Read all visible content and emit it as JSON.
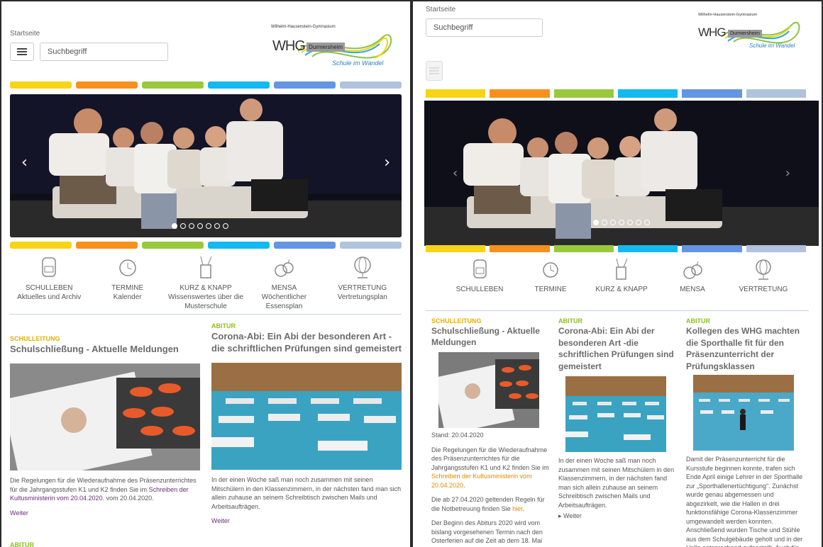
{
  "left": {
    "breadcrumb": "Startseite",
    "search_placeholder": "Suchbegriff",
    "logo": {
      "school": "Wilhelm-Hausenstein-Gymnasium",
      "short": "WHG",
      "town": "Durmersheim",
      "slogan": "Schule im Wandel"
    },
    "tiles": [
      {
        "title": "SCHULLEBEN",
        "sub": "Aktuelles und Archiv"
      },
      {
        "title": "TERMINE",
        "sub": "Kalender"
      },
      {
        "title": "KURZ & KNAPP",
        "sub": "Wissenswertes über die Musterschule"
      },
      {
        "title": "MENSA",
        "sub": "Wöchentlicher Essensplan"
      },
      {
        "title": "VERTRETUNG",
        "sub": "Vertretungsplan"
      }
    ],
    "articles": [
      {
        "category": "SCHULLEITUNG",
        "title": "Schulschließung - Aktuelle Meldungen",
        "text_before": "Die Regelungen für die Wiederaufnahme des Präsenzunterrichtes für die Jahrgangsstufen K1 und K2 finden Sie im ",
        "link": "Schreiben der Kultusministerin vom 20.04.2020",
        "text_after": ". vom 20.04.2020.",
        "more": "Weiter"
      },
      {
        "category": "ABITUR",
        "title": "Corona-Abi: Ein Abi der besonderen Art -die schriftlichen Prüfungen sind gemeistert",
        "text": "In der einen Woche saß man noch zusammen mit seinen Mitschülern in den Klassenzimmern, in der nächsten fand man sich allein zuhause an seinem Schreibtisch zwischen Mails und Arbeitsaufträgen.",
        "more": "Weiter"
      }
    ],
    "next_category": "ABITUR"
  },
  "right": {
    "breadcrumb": "Startseite",
    "search_placeholder": "Suchbegriff",
    "logo": {
      "school": "Wilhelm-Hausenstein-Gymnasium",
      "short": "WHG",
      "town": "Durmersheim",
      "slogan": "Schule im Wandel"
    },
    "tiles": [
      "SCHULLEBEN",
      "TERMINE",
      "KURZ & KNAPP",
      "MENSA",
      "VERTRETUNG"
    ],
    "articles": [
      {
        "category": "SCHULLEITUNG",
        "title": "Schulschließung - Aktuelle Meldungen",
        "stand": "Stand: 20.04.2020",
        "p1": "Die Regelungen für die Wiederaufnahme des Präsenzunterrichtes für die Jahrgangsstufen K1 und K2 finden Sie im ",
        "p1_link": "Schreiben der Kultusministerin vom 20.04.2020",
        "p1_end": ".",
        "p2": "Die ab 27.04.2020 geltenden Regeln für die Notbetreuung finden Sie ",
        "p2_link": "hier",
        "p2_end": ".",
        "p3": "Der Beginn des Abiturs 2020 wird vom bislang vorgesehenen Termin nach den Osterferien auf die Zeit ab dem 18. Mai"
      },
      {
        "category": "ABITUR",
        "title": "Corona-Abi: Ein Abi der besonderen Art -die schriftlichen Prüfungen sind gemeistert",
        "text": "In der einen Woche saß man noch zusammen mit seinen Mitschülern in den Klassenzimmern, in der nächsten fand man sich allein zuhause an seinem Schreibtisch zwischen Mails und Arbeitsaufträgen.",
        "more": "Weiter"
      },
      {
        "category": "ABITUR",
        "title": "Kollegen des WHG machten die Sporthalle fit für den Präsenzunterricht der Prüfungsklassen",
        "text": "Damit der Präsenzunterricht für die Kursstufe beginnen konnte, trafen sich Ende April einige Lehrer in der Sporthalle zur „Sporthallenertüchtigung“. Zunächst wurde genau abgemessen und abgezirkelt, wie die Hallen in drei funktionsfähige Corona-Klassenzimmer umgewandelt werden konnten. Anschließend wurden Tische und Stühle aus dem Schulgebäude geholt und in der Halle entsprechend aufgestellt. Auch für"
      }
    ]
  },
  "colors": {
    "yellow": "#f7d417",
    "orange": "#f7901e",
    "green": "#98c93c",
    "cyan": "#14b9ef",
    "blue": "#6495e3",
    "grey": "#b0c2de"
  }
}
